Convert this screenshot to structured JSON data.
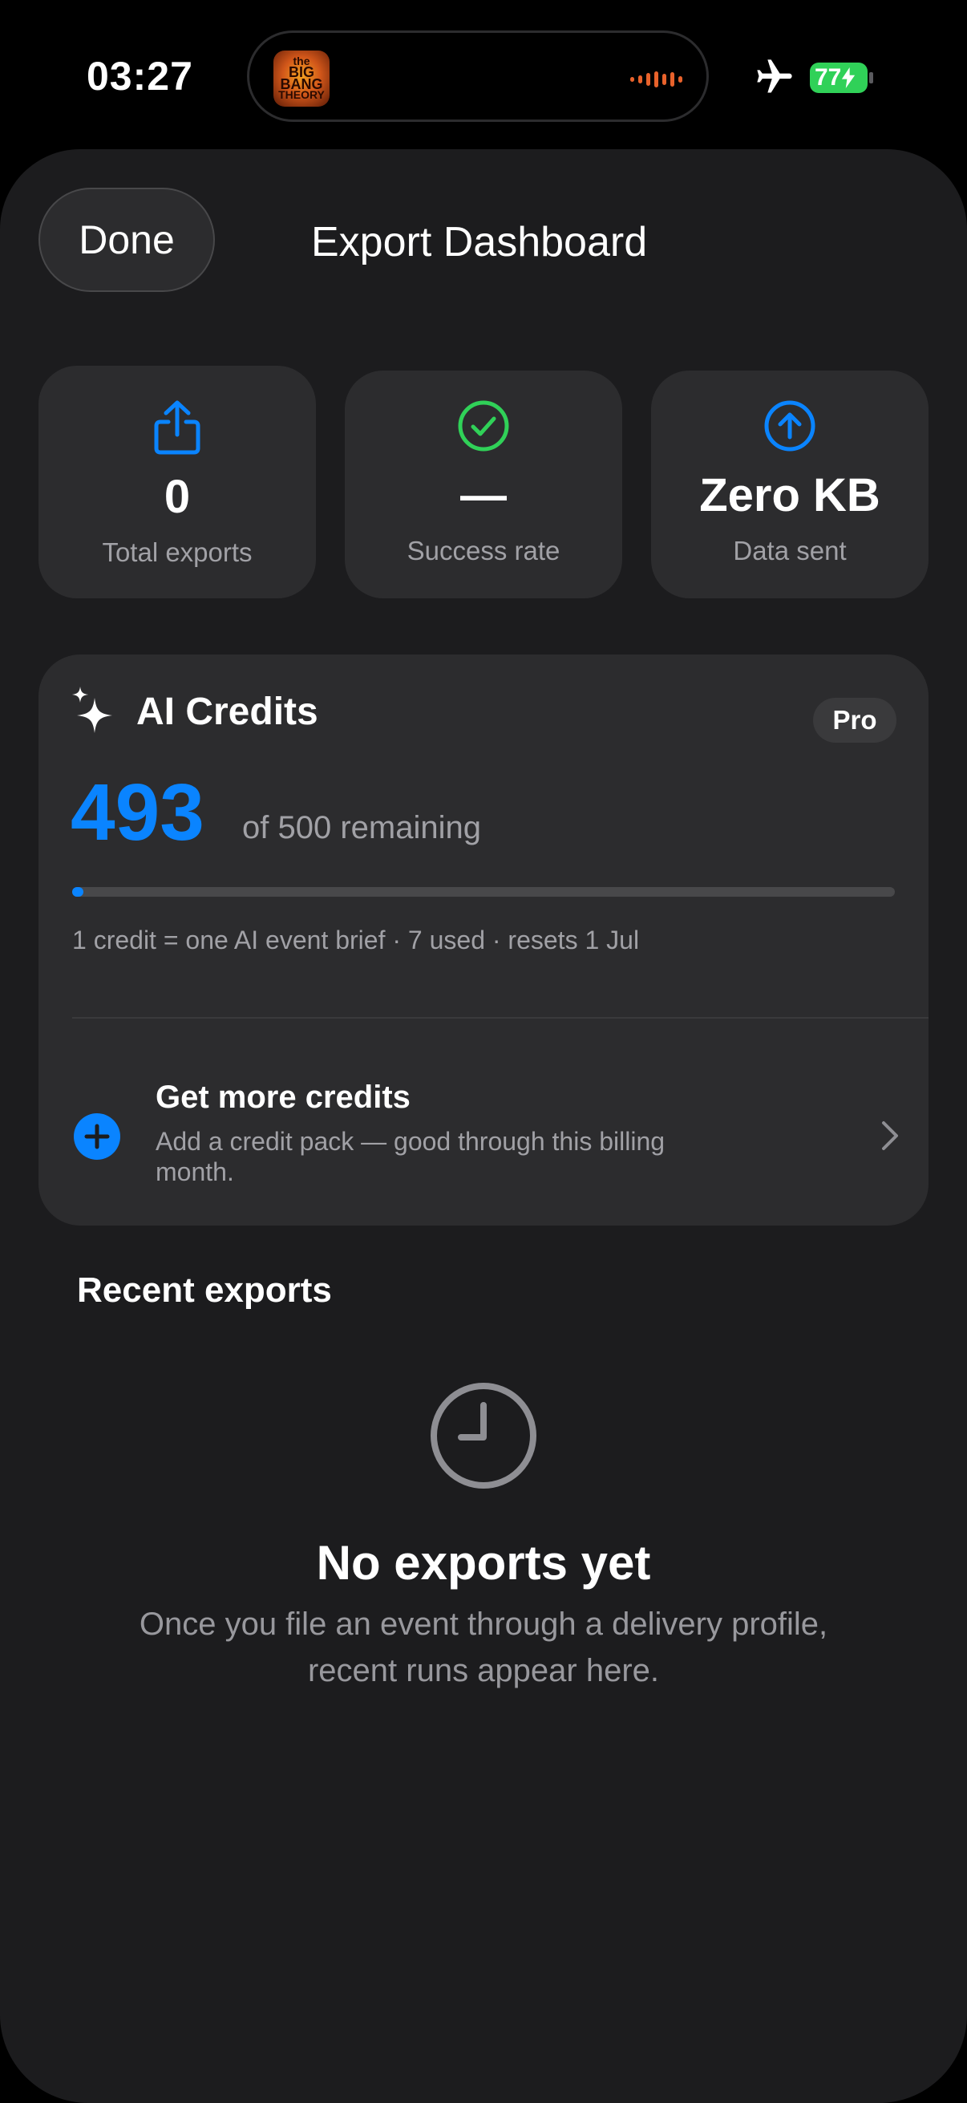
{
  "status_bar": {
    "time": "03:27",
    "battery": "77",
    "now_playing_art": [
      "the",
      "BIG",
      "BANG",
      "THEORY"
    ]
  },
  "header": {
    "done_label": "Done",
    "title": "Export Dashboard"
  },
  "stats": [
    {
      "value": "0",
      "label": "Total exports",
      "icon": "share-icon",
      "color": "#0a84ff"
    },
    {
      "value": "—",
      "label": "Success rate",
      "icon": "checkmark-circle-icon",
      "color": "#30d158"
    },
    {
      "value": "Zero KB",
      "label": "Data sent",
      "icon": "arrow-up-circle-icon",
      "color": "#0a84ff"
    }
  ],
  "credits": {
    "title": "AI Credits",
    "badge": "Pro",
    "remaining": "493",
    "of_text": "of 500 remaining",
    "used_fraction": 0.014,
    "note": "1 credit = one AI event brief · 7 used · resets 1 Jul",
    "more_title": "Get more credits",
    "more_subtitle": "Add a credit pack — good through this billing month."
  },
  "recent": {
    "title": "Recent exports",
    "empty_title": "No exports yet",
    "empty_subtitle": "Once you file an event through a delivery profile, recent runs appear here."
  },
  "colors": {
    "accent": "#0a84ff",
    "success": "#30d158",
    "battery": "#30d158"
  }
}
